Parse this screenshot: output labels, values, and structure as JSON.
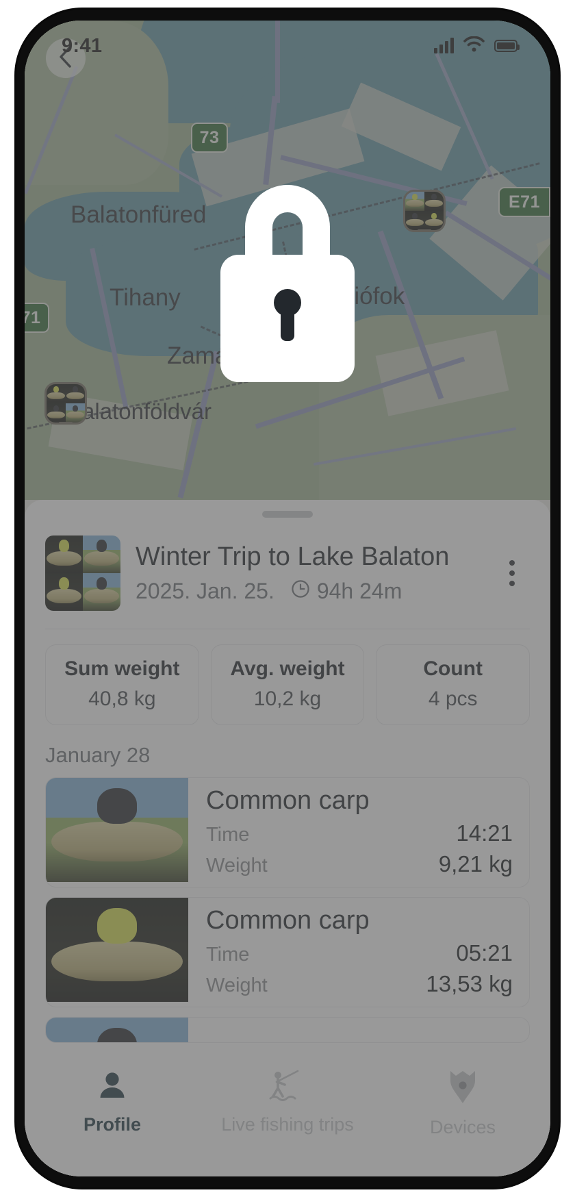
{
  "status_bar": {
    "time": "9:41",
    "icons": [
      "cellular-signal-icon",
      "wifi-icon",
      "battery-icon"
    ]
  },
  "map": {
    "back_icon": "chevron-left-icon",
    "places": [
      {
        "name": "Balatonfüred"
      },
      {
        "name": "Tihany"
      },
      {
        "name": "Zamárdi"
      },
      {
        "name": "Balatonföldvár"
      },
      {
        "name": "Siófok"
      }
    ],
    "road_shields": [
      "73",
      "E71",
      "71"
    ],
    "pins": [
      {
        "name": "catch-photo-cluster-pin",
        "photos": 4
      },
      {
        "name": "catch-photo-cluster-pin",
        "photos": 4
      }
    ]
  },
  "overlay": {
    "icon": "lock-icon",
    "lock_color": "#ffffff",
    "keyhole_color": "#23282d",
    "dim_color": "rgba(90,90,90,0.62)"
  },
  "sheet": {
    "grab_handle": "drag-handle",
    "trip": {
      "title": "Winter Trip to Lake Balaton",
      "date": "2025. Jan. 25.",
      "duration": "94h 24m",
      "duration_icon": "clock-icon",
      "menu_icon": "more-vertical-icon",
      "thumbnail_photos": 4
    },
    "stats": [
      {
        "label": "Sum weight",
        "value": "40,8 kg"
      },
      {
        "label": "Avg. weight",
        "value": "10,2 kg"
      },
      {
        "label": "Count",
        "value": "4 pcs"
      }
    ],
    "day_section": "January 28",
    "catch_labels": {
      "time": "Time",
      "weight": "Weight"
    },
    "catches": [
      {
        "species": "Common carp",
        "time": "14:21",
        "weight": "9,21 kg"
      },
      {
        "species": "Common carp",
        "time": "05:21",
        "weight": "13,53 kg"
      }
    ]
  },
  "tabs": [
    {
      "label": "Profile",
      "icon": "person-icon",
      "active": true
    },
    {
      "label": "Live fishing trips",
      "icon": "angler-icon",
      "active": false
    },
    {
      "label": "Devices",
      "icon": "device-pin-icon",
      "active": false
    }
  ],
  "colors": {
    "accent": "#1c3640",
    "inactive": "#c3c6c9",
    "sheet_bg": "#ffffff"
  }
}
